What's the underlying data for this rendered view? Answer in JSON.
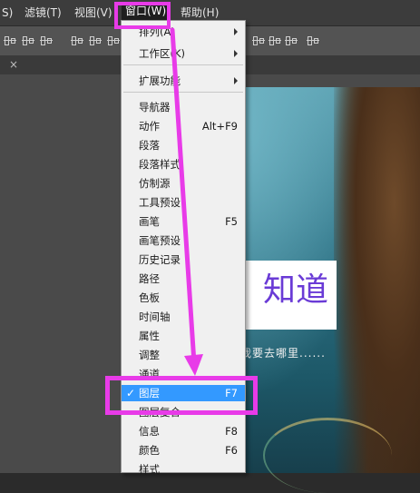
{
  "menubar": {
    "items": [
      {
        "label": "S)"
      },
      {
        "label": "滤镜(T)"
      },
      {
        "label": "视图(V)"
      },
      {
        "label": "窗口(W)"
      },
      {
        "label": "帮助(H)"
      }
    ]
  },
  "tab": {
    "close_glyph": "×"
  },
  "canvas_image": {
    "title_text": "知道",
    "subtitle_text": "我要去哪里......"
  },
  "window_menu": {
    "items": [
      {
        "label": "排列(A)",
        "submenu": true
      },
      {
        "label": "工作区(K)",
        "submenu": true
      },
      {
        "label": "扩展功能",
        "submenu": true
      },
      {
        "label": "导航器"
      },
      {
        "label": "动作",
        "shortcut": "Alt+F9"
      },
      {
        "label": "段落"
      },
      {
        "label": "段落样式"
      },
      {
        "label": "仿制源"
      },
      {
        "label": "工具预设"
      },
      {
        "label": "画笔",
        "shortcut": "F5"
      },
      {
        "label": "画笔预设"
      },
      {
        "label": "历史记录"
      },
      {
        "label": "路径"
      },
      {
        "label": "色板"
      },
      {
        "label": "时间轴"
      },
      {
        "label": "属性"
      },
      {
        "label": "调整"
      },
      {
        "label": "通道"
      },
      {
        "label": "图层",
        "shortcut": "F7",
        "checked": true,
        "check_glyph": "✓",
        "highlighted": true
      },
      {
        "label": "图层复合"
      },
      {
        "label": "信息",
        "shortcut": "F8"
      },
      {
        "label": "颜色",
        "shortcut": "F6"
      },
      {
        "label": "样式"
      }
    ]
  },
  "colors": {
    "annotation": "#e83be8",
    "menu_highlight": "#3399ff",
    "image_text": "#6a3bd6"
  }
}
